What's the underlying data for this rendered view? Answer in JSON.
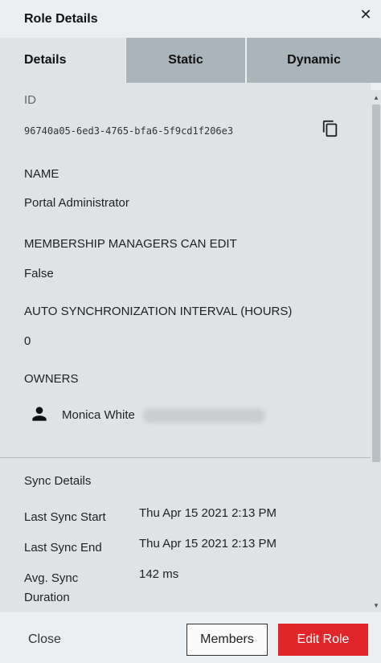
{
  "header": {
    "title": "Role Details",
    "close_glyph": "✕"
  },
  "tabs": [
    {
      "label": "Details",
      "active": true
    },
    {
      "label": "Static",
      "active": false
    },
    {
      "label": "Dynamic",
      "active": false
    }
  ],
  "details": {
    "id_label": "ID",
    "id_value": "96740a05-6ed3-4765-bfa6-5f9cd1f206e3",
    "copy_icon": "copy-icon",
    "name_label": "NAME",
    "name_value": "Portal Administrator",
    "mm_label": "MEMBERSHIP MANAGERS CAN EDIT",
    "mm_value": "False",
    "auto_sync_label": "AUTO SYNCHRONIZATION INTERVAL (HOURS)",
    "auto_sync_value": "0",
    "owners_label": "OWNERS",
    "owners": [
      {
        "name": "Monica White",
        "email_redacted": true
      }
    ]
  },
  "sync": {
    "title": "Sync Details",
    "rows": [
      {
        "key": "Last Sync Start",
        "value": "Thu Apr 15 2021 2:13 PM"
      },
      {
        "key": "Last Sync End",
        "value": "Thu Apr 15 2021 2:13 PM"
      },
      {
        "key": "Avg. Sync Duration",
        "value": "142 ms"
      }
    ]
  },
  "footer": {
    "close_label": "Close",
    "members_label": "Members",
    "edit_label": "Edit Role"
  },
  "colors": {
    "accent": "#e0262b",
    "tab_active": "#dfe3e6",
    "tab_inactive": "#aab5bb"
  }
}
